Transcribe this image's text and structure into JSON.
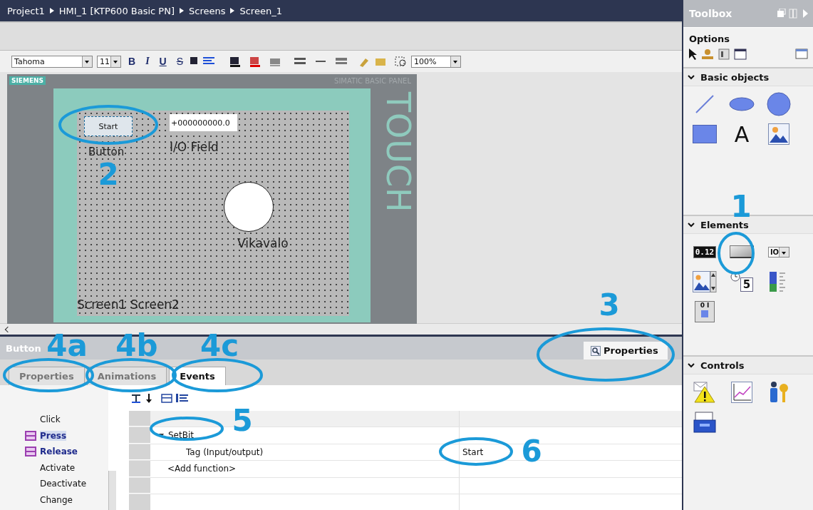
{
  "breadcrumb": [
    "Project1",
    "HMI_1 [KTP600 Basic PN]",
    "Screens",
    "Screen_1"
  ],
  "format_toolbar": {
    "font": "Tahoma",
    "size": "11",
    "styles": [
      "B",
      "I",
      "U",
      "S"
    ],
    "zoom": "100%"
  },
  "device": {
    "brand": "SIEMENS",
    "model": "SIMATIC BASIC PANEL",
    "type": "TOUCH"
  },
  "screen_objects": [
    {
      "kind": "button",
      "text": "Start",
      "caption": "Button",
      "selected": true
    },
    {
      "kind": "io_field",
      "text": "+000000000.0",
      "caption": "I/O Field",
      "selected": false
    },
    {
      "kind": "lamp",
      "caption": "Vikavalo",
      "selected": false
    },
    {
      "kind": "label",
      "text": "Screen1 Screen2",
      "selected": false
    }
  ],
  "inspector": {
    "title": "Button",
    "view_tab": "Properties",
    "tabs": [
      {
        "label": "Properties",
        "selected": false
      },
      {
        "label": "Animations",
        "selected": false
      },
      {
        "label": "Events",
        "selected": true
      }
    ],
    "events": [
      {
        "label": "Click",
        "has_function": false,
        "selected": false
      },
      {
        "label": "Press",
        "has_function": true,
        "selected": true
      },
      {
        "label": "Release",
        "has_function": true,
        "selected": false
      },
      {
        "label": "Activate",
        "has_function": false,
        "selected": false
      },
      {
        "label": "Deactivate",
        "has_function": false,
        "selected": false
      },
      {
        "label": "Change",
        "has_function": false,
        "selected": false
      }
    ],
    "functions": [
      {
        "kind": "function",
        "name": "SetBit",
        "expanded": true,
        "children": [
          {
            "name": "Tag (Input/output)",
            "value": "Start"
          }
        ]
      },
      {
        "kind": "add",
        "name": "<Add function>"
      }
    ]
  },
  "toolbox": {
    "title": "Toolbox",
    "options": "Options",
    "sections": [
      {
        "title": "Basic objects",
        "expanded": true,
        "items": [
          {
            "kind": "line"
          },
          {
            "kind": "ellipse"
          },
          {
            "kind": "circle"
          },
          {
            "kind": "rectangle"
          },
          {
            "kind": "text",
            "label": "A"
          },
          {
            "kind": "graphic"
          }
        ]
      },
      {
        "title": "Elements",
        "expanded": true,
        "items": [
          {
            "kind": "io",
            "label": "0.12"
          },
          {
            "kind": "button"
          },
          {
            "kind": "symbolic",
            "label": "IO"
          },
          {
            "kind": "graphic_io"
          },
          {
            "kind": "date",
            "label": "5"
          },
          {
            "kind": "bar"
          },
          {
            "kind": "switch",
            "label": "0 I"
          }
        ]
      },
      {
        "title": "Controls",
        "expanded": true,
        "items": [
          {
            "kind": "alarm"
          },
          {
            "kind": "trend"
          },
          {
            "kind": "user"
          },
          {
            "kind": "recipe"
          }
        ]
      }
    ]
  },
  "annotations": [
    "1",
    "2",
    "3",
    "4a",
    "4b",
    "4c",
    "5",
    "6"
  ]
}
